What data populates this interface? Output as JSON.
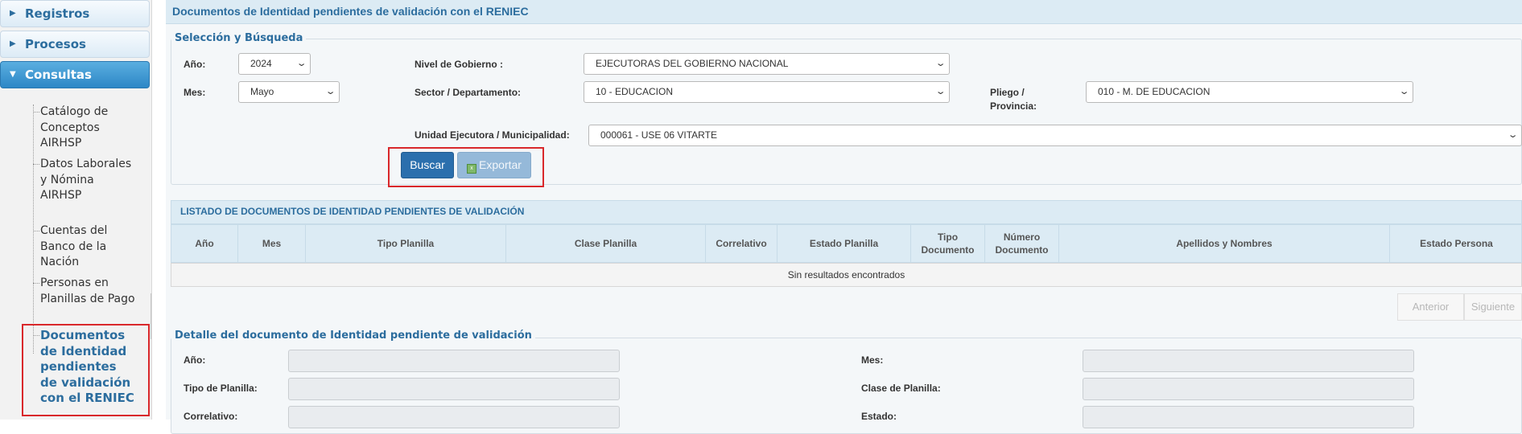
{
  "sidebar": {
    "sections": [
      {
        "label": "Registros",
        "expanded": false
      },
      {
        "label": "Procesos",
        "expanded": false
      },
      {
        "label": "Consultas",
        "expanded": true
      }
    ],
    "items": [
      {
        "label": "Catálogo de Conceptos AIRHSP"
      },
      {
        "label": "Datos Laborales y Nómina AIRHSP"
      },
      {
        "label": "Cuentas del Banco de la Nación"
      },
      {
        "label": "Personas en Planillas de Pago"
      },
      {
        "label": "Documentos de Identidad pendientes de validación con el RENIEC",
        "selected": true
      }
    ]
  },
  "page": {
    "title": "Documentos de Identidad pendientes de validación con el RENIEC"
  },
  "search": {
    "legend": "Selección y Búsqueda",
    "anio": {
      "label": "Año:",
      "value": "2024"
    },
    "mes": {
      "label": "Mes:",
      "value": "Mayo"
    },
    "nivel": {
      "label": "Nivel de Gobierno :",
      "value": "EJECUTORAS DEL GOBIERNO NACIONAL"
    },
    "sector": {
      "label": "Sector / Departamento:",
      "value": "10 - EDUCACION"
    },
    "pliego": {
      "label_1": "Pliego /",
      "label_2": "Provincia:",
      "value": "010 - M. DE EDUCACION"
    },
    "unidad": {
      "label": "Unidad Ejecutora / Municipalidad:",
      "value": "000061 - USE 06 VITARTE"
    },
    "buscar_label": "Buscar",
    "exportar_label": "Exportar"
  },
  "table": {
    "title": "LISTADO DE DOCUMENTOS DE IDENTIDAD PENDIENTES DE VALIDACIÓN",
    "columns": [
      {
        "l1": "Año",
        "l2": ""
      },
      {
        "l1": "Mes",
        "l2": ""
      },
      {
        "l1": "Tipo Planilla",
        "l2": ""
      },
      {
        "l1": "Clase Planilla",
        "l2": ""
      },
      {
        "l1": "Correlativo",
        "l2": ""
      },
      {
        "l1": "Estado Planilla",
        "l2": ""
      },
      {
        "l1": "Tipo",
        "l2": "Documento"
      },
      {
        "l1": "Número",
        "l2": "Documento"
      },
      {
        "l1": "Apellidos y Nombres",
        "l2": ""
      },
      {
        "l1": "Estado Persona",
        "l2": ""
      }
    ],
    "empty_message": "Sin resultados encontrados",
    "prev_label": "Anterior",
    "next_label": "Siguiente"
  },
  "detail": {
    "legend": "Detalle del documento de Identidad pendiente de validación",
    "fields_left": [
      {
        "label": "Año:"
      },
      {
        "label": "Tipo de Planilla:"
      },
      {
        "label": "Correlativo:"
      }
    ],
    "fields_right": [
      {
        "label": "Mes:"
      },
      {
        "label": "Clase de Planilla:"
      },
      {
        "label": "Estado:"
      }
    ]
  },
  "colors": {
    "accent": "#2c6d9e",
    "primary_button": "#2b6fad",
    "highlight": "#d9282b",
    "header_bg": "#dcebf4"
  }
}
